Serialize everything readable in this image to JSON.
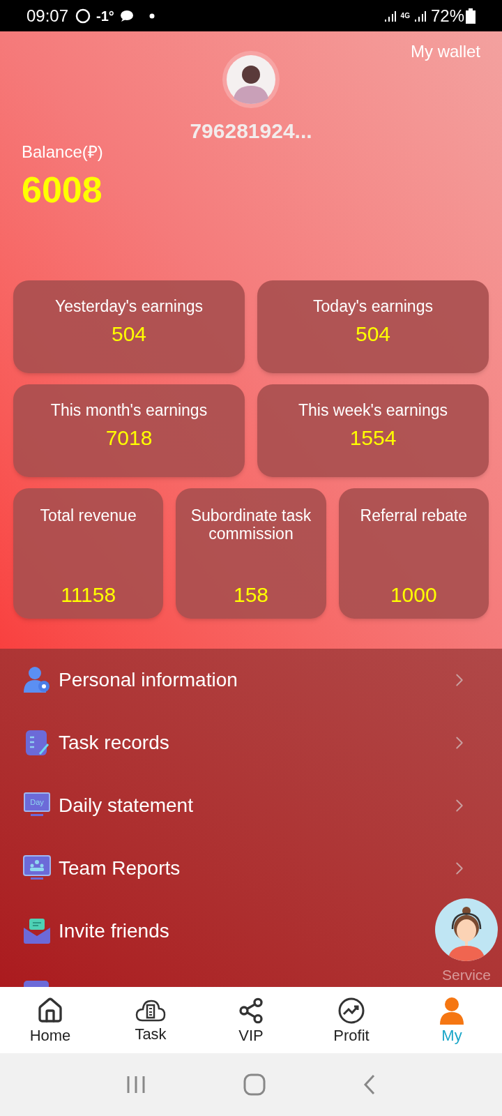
{
  "status_bar": {
    "time": "09:07",
    "temperature": "-1°",
    "network": "4G",
    "battery": "72%"
  },
  "header": {
    "wallet_link": "My wallet",
    "username": "796281924...",
    "balance_label": "Balance(₽)",
    "balance": "6008"
  },
  "stats": [
    {
      "label": "Yesterday's earnings",
      "value": "504"
    },
    {
      "label": "Today's earnings",
      "value": "504"
    },
    {
      "label": "This month's earnings",
      "value": "7018"
    },
    {
      "label": "This week's earnings",
      "value": "1554"
    },
    {
      "label": "Total revenue",
      "value": "11158"
    },
    {
      "label": "Subordinate task commission",
      "value": "158"
    },
    {
      "label": "Referral rebate",
      "value": "1000"
    }
  ],
  "menu": [
    {
      "label": "Personal information"
    },
    {
      "label": "Task records"
    },
    {
      "label": "Daily statement",
      "icon_text": "Day"
    },
    {
      "label": "Team Reports"
    },
    {
      "label": "Invite friends"
    }
  ],
  "service": {
    "label": "Service"
  },
  "tab_bar": [
    {
      "label": "Home",
      "selected": false
    },
    {
      "label": "Task",
      "selected": false
    },
    {
      "label": "VIP",
      "selected": false
    },
    {
      "label": "Profit",
      "selected": false
    },
    {
      "label": "My",
      "selected": true
    }
  ]
}
